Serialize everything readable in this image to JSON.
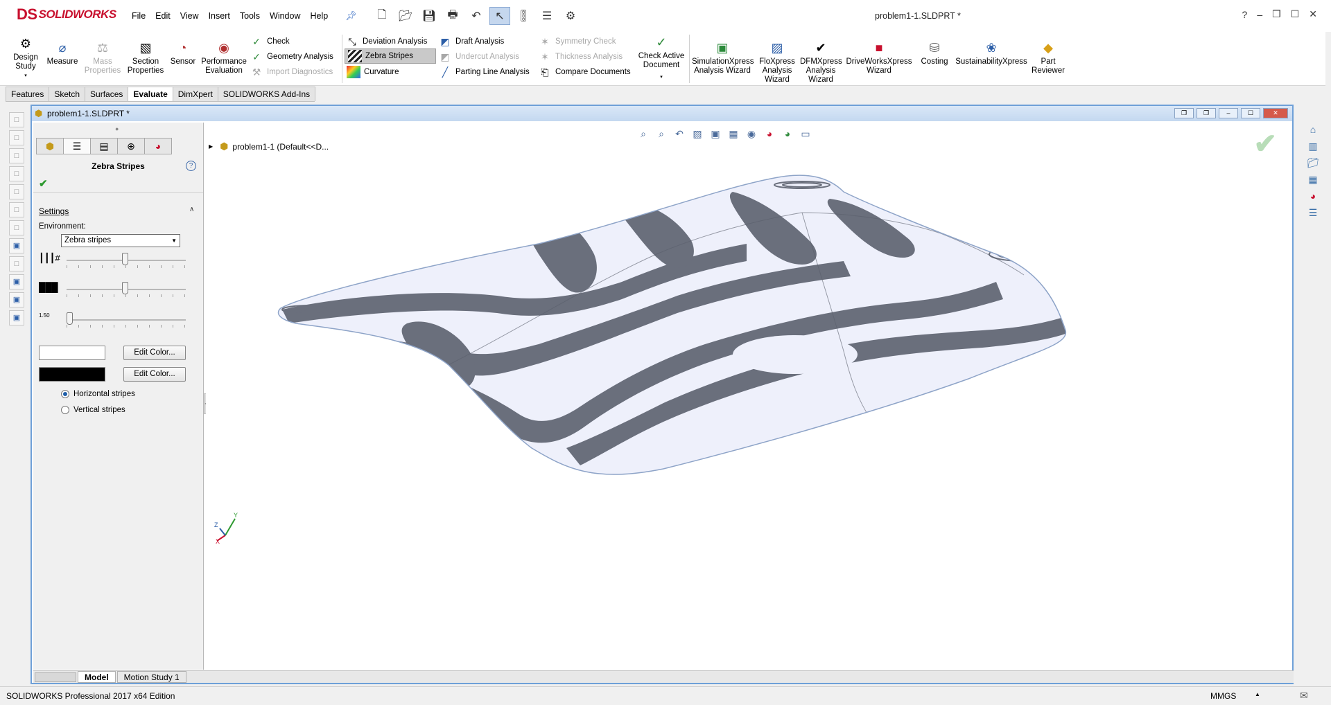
{
  "app": {
    "logo_ds": "DS",
    "logo_text": "SOLIDWORKS",
    "document_title": "problem1-1.SLDPRT *"
  },
  "menu": [
    "File",
    "Edit",
    "View",
    "Insert",
    "Tools",
    "Window",
    "Help"
  ],
  "ribbon": {
    "design_study": "Design\nStudy",
    "measure": "Measure",
    "mass_properties": "Mass\nProperties",
    "section_properties": "Section\nProperties",
    "sensor": "Sensor",
    "performance_evaluation": "Performance\nEvaluation",
    "check": "Check",
    "geometry_analysis": "Geometry Analysis",
    "import_diagnostics": "Import Diagnostics",
    "deviation_analysis": "Deviation Analysis",
    "zebra_stripes": "Zebra Stripes",
    "curvature": "Curvature",
    "draft_analysis": "Draft Analysis",
    "undercut_analysis": "Undercut Analysis",
    "parting_line_analysis": "Parting Line Analysis",
    "symmetry_check": "Symmetry Check",
    "thickness_analysis": "Thickness Analysis",
    "compare_documents": "Compare Documents",
    "check_active_document": "Check Active\nDocument",
    "simulationxpress": "SimulationXpress\nAnalysis Wizard",
    "floxpress": "FloXpress\nAnalysis\nWizard",
    "dfmxpress": "DFMXpress\nAnalysis\nWizard",
    "driveworksxpress": "DriveWorksXpress\nWizard",
    "costing": "Costing",
    "sustainabilityxpress": "SustainabilityXpress",
    "part_reviewer": "Part\nReviewer"
  },
  "tabs": [
    "Features",
    "Sketch",
    "Surfaces",
    "Evaluate",
    "DimXpert",
    "SOLIDWORKS Add-Ins"
  ],
  "active_tab": "Evaluate",
  "docwin": {
    "title": "problem1-1.SLDPRT *"
  },
  "property_manager": {
    "title": "Zebra Stripes",
    "settings_label": "Settings",
    "environment_label": "Environment:",
    "environment_value": "Zebra stripes",
    "slider_number_value": 0.5,
    "slider_width_value": 0.5,
    "slider_precision_value": 0.0,
    "precision_icon_text": "1.50",
    "color1": "#ffffff",
    "color2": "#000000",
    "edit_color_label": "Edit Color...",
    "edit_color_label2": "Edit Color...",
    "radio_horizontal": "Horizontal stripes",
    "radio_vertical": "Vertical stripes",
    "selected_orientation": "horizontal"
  },
  "feature_tree": {
    "root_label": "problem1-1  (Default<<D..."
  },
  "triad": {
    "x": "X",
    "y": "Y",
    "z": "Z"
  },
  "bottom_tabs": [
    "Model",
    "Motion Study 1"
  ],
  "status": {
    "text": "SOLIDWORKS Professional 2017 x64 Edition",
    "units": "MMGS"
  },
  "colors": {
    "accent": "#c8102e",
    "stripe_dark": "#6a6f7c",
    "stripe_light": "#eef0fb",
    "doc_frame": "#6ea0d8"
  }
}
